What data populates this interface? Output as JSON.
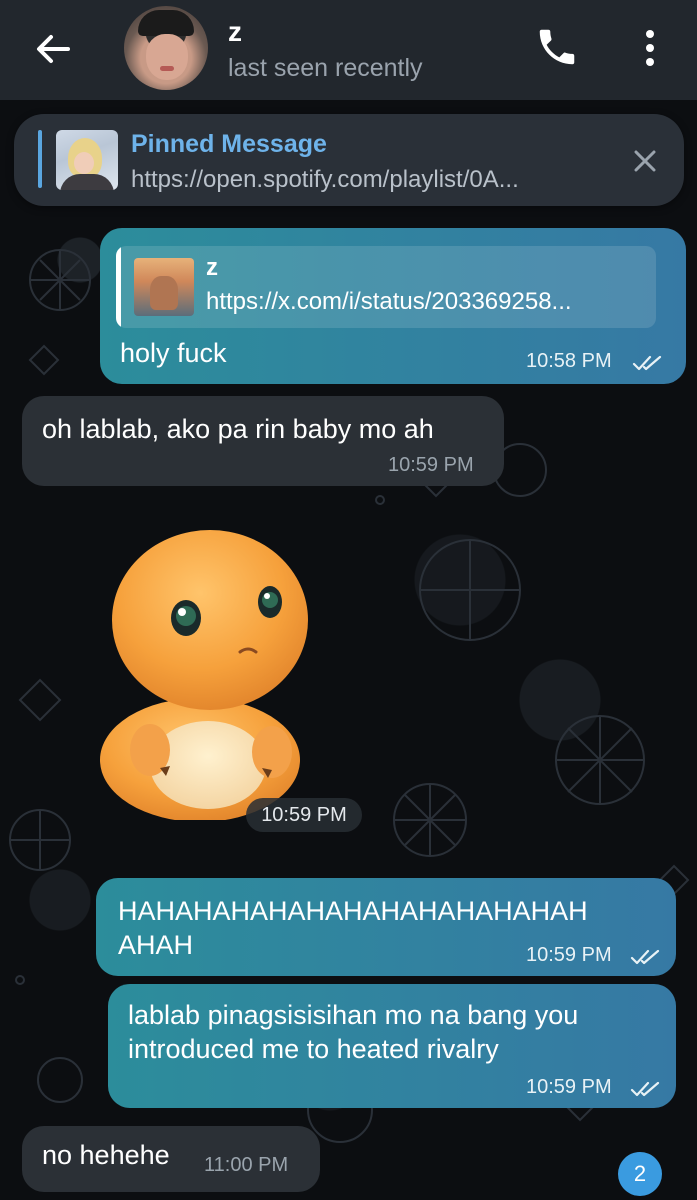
{
  "header": {
    "name": "z",
    "status": "last seen recently"
  },
  "pinned": {
    "title": "Pinned Message",
    "text": "https://open.spotify.com/playlist/0A..."
  },
  "messages": {
    "m1": {
      "reply_name": "z",
      "reply_text": "https://x.com/i/status/203369258...",
      "text": "holy fuck",
      "time": "10:58 PM"
    },
    "m2": {
      "text": "oh lablab, ako pa rin baby mo ah",
      "time": "10:59 PM"
    },
    "m3": {
      "time": "10:59 PM"
    },
    "m4": {
      "line1": "HAHAHAHAHAHAHAHAHAHAHAHAH",
      "line2": "AHAH",
      "time": "10:59 PM"
    },
    "m5": {
      "line1": "lablab pinagsisisihan mo na bang you",
      "line2": "introduced me to heated rivalry",
      "time": "10:59 PM"
    },
    "m6": {
      "text": "no hehehe",
      "time": "11:00 PM"
    }
  },
  "unread_count": "2",
  "colors": {
    "header_bg": "#22272d",
    "outgoing_bubble_start": "#2c8d9b",
    "outgoing_bubble_end": "#3679a4",
    "incoming_bubble": "#2b3036",
    "pinned_accent": "#5aa6e0",
    "badge": "#3a9be0"
  },
  "icons": [
    "back-arrow-icon",
    "phone-icon",
    "more-vertical-icon",
    "close-icon",
    "double-check-icon"
  ]
}
